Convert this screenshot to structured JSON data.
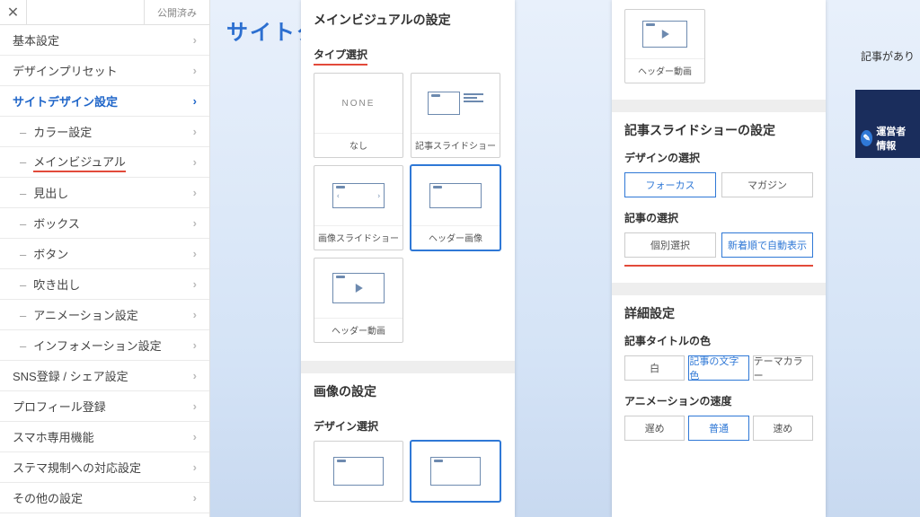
{
  "topbar": {
    "published": "公開済み"
  },
  "sidebar": {
    "items": [
      {
        "label": "基本設定",
        "sub": false,
        "active": false
      },
      {
        "label": "デザインプリセット",
        "sub": false,
        "active": false
      },
      {
        "label": "サイトデザイン設定",
        "sub": false,
        "active": true
      },
      {
        "label": "カラー設定",
        "sub": true,
        "active": false
      },
      {
        "label": "メインビジュアル",
        "sub": true,
        "active": false,
        "hl": true
      },
      {
        "label": "見出し",
        "sub": true,
        "active": false
      },
      {
        "label": "ボックス",
        "sub": true,
        "active": false
      },
      {
        "label": "ボタン",
        "sub": true,
        "active": false
      },
      {
        "label": "吹き出し",
        "sub": true,
        "active": false
      },
      {
        "label": "アニメーション設定",
        "sub": true,
        "active": false
      },
      {
        "label": "インフォメーション設定",
        "sub": true,
        "active": false
      },
      {
        "label": "SNS登録 / シェア設定",
        "sub": false,
        "active": false
      },
      {
        "label": "プロフィール登録",
        "sub": false,
        "active": false
      },
      {
        "label": "スマホ専用機能",
        "sub": false,
        "active": false
      },
      {
        "label": "ステマ規制への対応設定",
        "sub": false,
        "active": false
      },
      {
        "label": "その他の設定",
        "sub": false,
        "active": false
      }
    ]
  },
  "siteTitle": "サイトタ",
  "panel1": {
    "title": "メインビジュアルの設定",
    "typeLabel": "タイプ選択",
    "tiles": [
      {
        "cap": "なし",
        "kind": "none"
      },
      {
        "cap": "記事スライドショー",
        "kind": "article"
      },
      {
        "cap": "画像スライドショー",
        "kind": "slider"
      },
      {
        "cap": "ヘッダー画像",
        "kind": "header",
        "sel": true
      },
      {
        "cap": "ヘッダー動画",
        "kind": "video"
      }
    ],
    "imageTitle": "画像の設定",
    "designLabel": "デザイン選択"
  },
  "panel2": {
    "topTile": {
      "cap": "ヘッダー動画",
      "kind": "video"
    },
    "slideTitle": "記事スライドショーの設定",
    "designSel": {
      "label": "デザインの選択",
      "opts": [
        "フォーカス",
        "マガジン"
      ],
      "sel": 0
    },
    "articleSel": {
      "label": "記事の選択",
      "opts": [
        "個別選択",
        "新着順で自動表示"
      ],
      "sel": 1
    },
    "detailTitle": "詳細設定",
    "titleColor": {
      "label": "記事タイトルの色",
      "opts": [
        "白",
        "記事の文字色",
        "テーマカラー"
      ],
      "sel": 1
    },
    "animSpeed": {
      "label": "アニメーションの速度",
      "opts": [
        "遅め",
        "普通",
        "速め"
      ],
      "sel": 1
    }
  },
  "rightSide": {
    "snippet": "記事があり",
    "badge": "運営者情報"
  }
}
